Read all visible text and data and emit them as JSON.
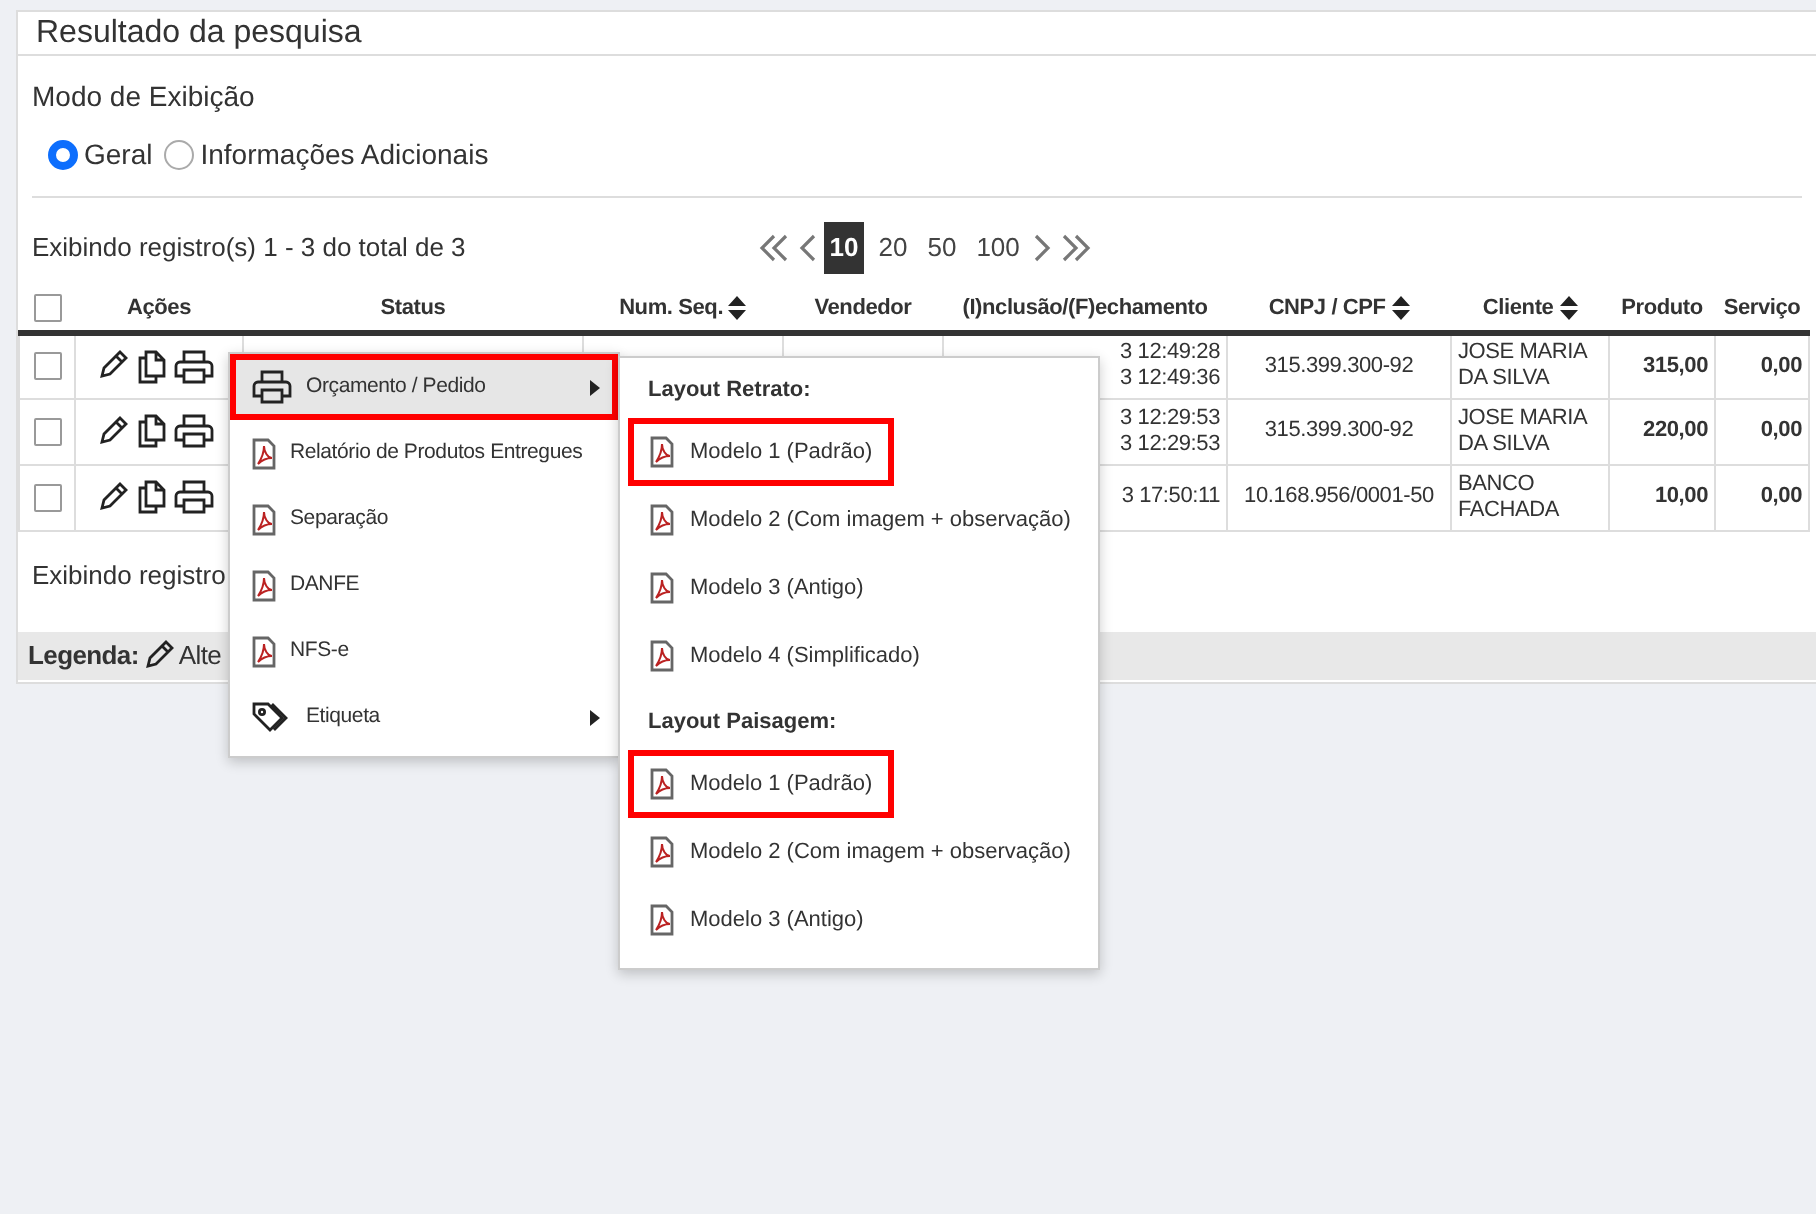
{
  "panel": {
    "title": "Resultado da pesquisa"
  },
  "display_mode": {
    "label": "Modo de Exibição",
    "options": [
      {
        "label": "Geral",
        "selected": true
      },
      {
        "label": "Informações Adicionais",
        "selected": false
      }
    ]
  },
  "summary_top": "Exibindo registro(s) 1 - 3 do total de 3",
  "pagination": {
    "page_sizes": [
      {
        "label": "10",
        "selected": true
      },
      {
        "label": "20",
        "selected": false
      },
      {
        "label": "50",
        "selected": false
      },
      {
        "label": "100",
        "selected": false
      }
    ]
  },
  "table": {
    "header_checked": false,
    "columns": [
      {
        "label": "Ações",
        "sortable": false
      },
      {
        "label": "Status",
        "sortable": false
      },
      {
        "label": "Num. Seq.",
        "sortable": true
      },
      {
        "label": "Vendedor",
        "sortable": false
      },
      {
        "label": "(I)nclusão/(F)echamento",
        "sortable": false
      },
      {
        "label": "CNPJ / CPF",
        "sortable": true
      },
      {
        "label": "Cliente",
        "sortable": true
      },
      {
        "label": "Produto",
        "sortable": false
      },
      {
        "label": "Serviço",
        "sortable": false
      }
    ],
    "rows": [
      {
        "checked": false,
        "inclusion": [
          "3 12:49:28",
          "3 12:49:36"
        ],
        "cnpj_cpf": "315.399.300-92",
        "cliente": "JOSE MARIA DA SILVA",
        "produto": "315,00",
        "servico": "0,00"
      },
      {
        "checked": false,
        "inclusion": [
          "3 12:29:53",
          "3 12:29:53"
        ],
        "cnpj_cpf": "315.399.300-92",
        "cliente": "JOSE MARIA DA SILVA",
        "produto": "220,00",
        "servico": "0,00"
      },
      {
        "checked": false,
        "inclusion": [
          "3 17:50:11"
        ],
        "cnpj_cpf": "10.168.956/0001-50",
        "cliente": "BANCO FACHADA",
        "produto": "10,00",
        "servico": "0,00"
      }
    ]
  },
  "summary_bottom": "Exibindo registro",
  "legend": {
    "label": "Legenda:",
    "items": [
      "Alte"
    ]
  },
  "print_menu": {
    "items": [
      {
        "label": "Orçamento / Pedido",
        "kind": "printer",
        "submenu": true,
        "active": true,
        "highlighted": true
      },
      {
        "label": "Relatório de Produtos Entregues",
        "kind": "pdf",
        "submenu": false,
        "active": false,
        "highlighted": false
      },
      {
        "label": "Separação",
        "kind": "pdf",
        "submenu": false,
        "active": false,
        "highlighted": false
      },
      {
        "label": "DANFE",
        "kind": "pdf",
        "submenu": false,
        "active": false,
        "highlighted": false
      },
      {
        "label": "NFS-e",
        "kind": "pdf",
        "submenu": false,
        "active": false,
        "highlighted": false
      },
      {
        "label": "Etiqueta",
        "kind": "tag",
        "submenu": true,
        "active": false,
        "highlighted": false
      }
    ]
  },
  "submenu": {
    "groups": [
      {
        "heading": "Layout Retrato:",
        "items": [
          {
            "label": "Modelo 1 (Padrão)",
            "highlighted": true
          },
          {
            "label": "Modelo 2 (Com imagem + observação)",
            "highlighted": false
          },
          {
            "label": "Modelo 3 (Antigo)",
            "highlighted": false
          },
          {
            "label": "Modelo 4 (Simplificado)",
            "highlighted": false
          }
        ]
      },
      {
        "heading": "Layout Paisagem:",
        "items": [
          {
            "label": "Modelo 1 (Padrão)",
            "highlighted": true
          },
          {
            "label": "Modelo 2 (Com imagem + observação)",
            "highlighted": false
          },
          {
            "label": "Modelo 3 (Antigo)",
            "highlighted": false
          }
        ]
      }
    ]
  }
}
